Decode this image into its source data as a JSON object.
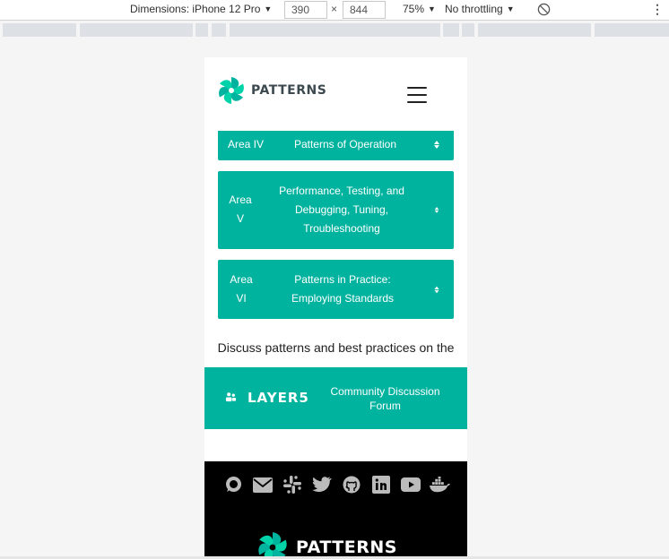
{
  "devtools": {
    "dimensions_label": "Dimensions: iPhone 12 Pro",
    "width": "390",
    "height": "844",
    "times": "×",
    "zoom": "75%",
    "throttling": "No throttling"
  },
  "header": {
    "logo_text": "PATTERNS"
  },
  "areas": [
    {
      "num": "Area IV",
      "title": "Patterns of Operation"
    },
    {
      "num_lines": [
        "Area",
        "V"
      ],
      "title_lines": [
        "Performance, Testing, and",
        "Debugging, Tuning,",
        "Troubleshooting"
      ]
    },
    {
      "num_lines": [
        "Area",
        "VI"
      ],
      "title_lines": [
        "Patterns in Practice:",
        "Employing Standards"
      ]
    }
  ],
  "discuss": {
    "text": "Discuss patterns and best practices on the"
  },
  "layer5": {
    "logo_text": "LAYER5",
    "cta_line1": "Community Discussion",
    "cta_line2": "Forum"
  },
  "footer": {
    "social_icons": [
      "discuss-icon",
      "mail-icon",
      "slack-icon",
      "twitter-icon",
      "github-icon",
      "linkedin-icon",
      "youtube-icon",
      "docker-icon"
    ],
    "logo_text": "PATTERNS"
  },
  "colors": {
    "accent": "#00b39f",
    "footer_bg": "#000000",
    "icon_gray": "#bbbbbb"
  }
}
